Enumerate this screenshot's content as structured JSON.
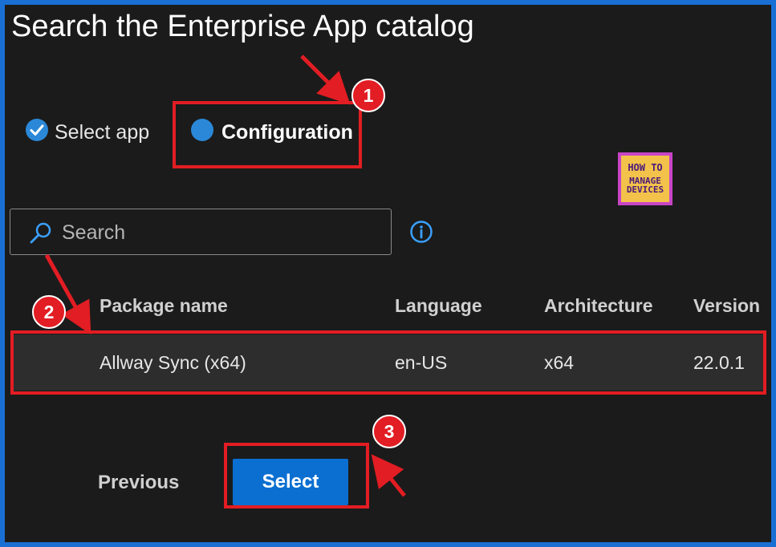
{
  "page": {
    "title": "Search the Enterprise App catalog"
  },
  "wizard": {
    "steps": [
      {
        "label": "Select app",
        "state": "completed"
      },
      {
        "label": "Configuration",
        "state": "current"
      }
    ]
  },
  "search": {
    "placeholder": "Search",
    "value": ""
  },
  "table": {
    "columns": [
      "Package name",
      "Language",
      "Architecture",
      "Version"
    ],
    "rows": [
      {
        "package_name": "Allway Sync (x64)",
        "language": "en-US",
        "architecture": "x64",
        "version": "22.0.1"
      }
    ]
  },
  "footer": {
    "previous_label": "Previous",
    "select_label": "Select"
  },
  "annotations": {
    "badges": [
      "1",
      "2",
      "3"
    ],
    "highlight_color": "#e21d23"
  },
  "watermark": {
    "line1": "HOW TO",
    "line2": "MANAGE",
    "line3": "DEVICES"
  },
  "colors": {
    "accent": "#0b6fd1",
    "background": "#1b1b1b",
    "frame": "#1a6fd4"
  }
}
